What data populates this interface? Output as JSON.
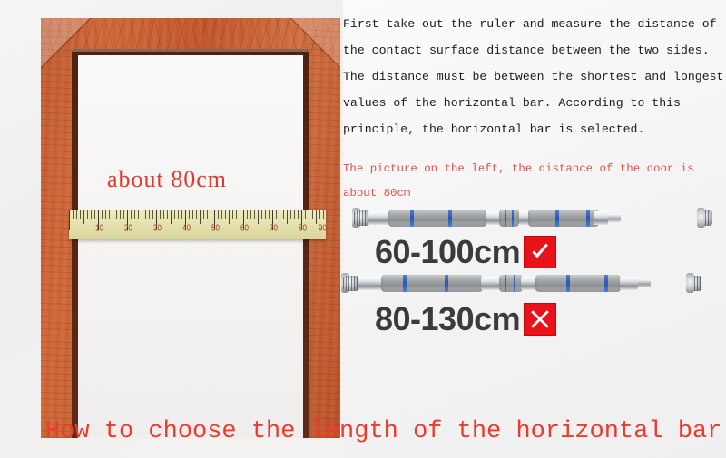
{
  "background": {
    "page_color": "#f3f2f2",
    "accent_red": "#e8131a",
    "wood_color": "#c4582c"
  },
  "photo": {
    "door_caption": "about 80cm",
    "ruler": {
      "name": "tape-measure",
      "tick_labels": [
        "10",
        "20",
        "30",
        "40",
        "50",
        "60",
        "70",
        "80",
        "90"
      ]
    }
  },
  "instructions": {
    "lines": [
      "First take out the ruler and measure the distance of",
      "the contact surface distance between the two sides.",
      "The distance must be between the shortest and longest",
      "values of the horizontal bar. According to this",
      "principle, the horizontal bar is selected."
    ]
  },
  "note": {
    "color": "#e0514a",
    "lines": [
      "The picture on the left, the distance of the door is",
      "about 80cm"
    ]
  },
  "products": [
    {
      "size_label": "60-100cm",
      "verdict": "check",
      "verdict_name": "check-icon"
    },
    {
      "size_label": "80-130cm",
      "verdict": "cross",
      "verdict_name": "cross-icon"
    }
  ],
  "headline": {
    "text": "How to choose the length of the horizontal bar",
    "color": "#f0392e"
  }
}
